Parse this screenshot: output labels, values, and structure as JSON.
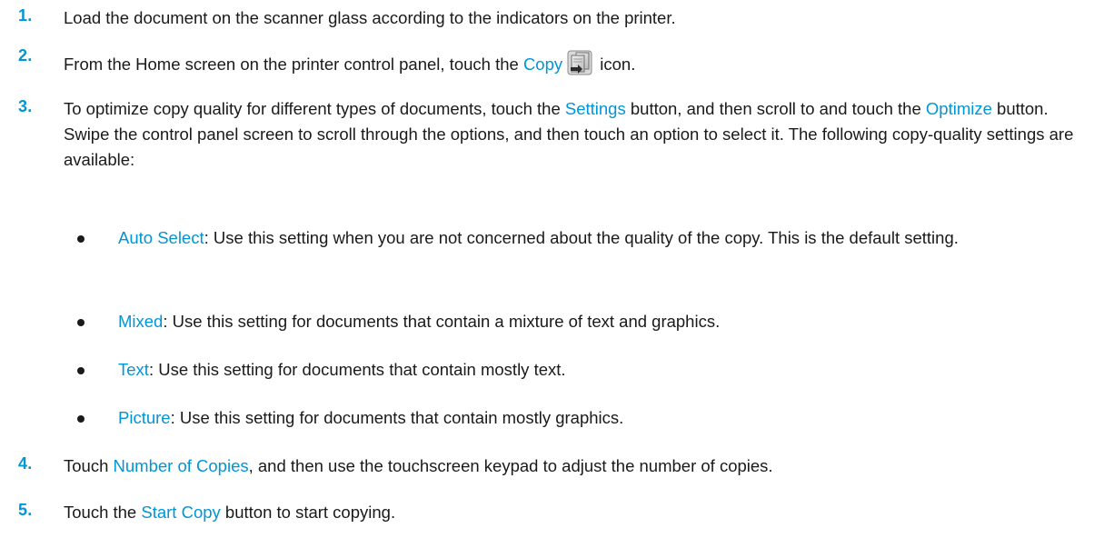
{
  "steps": [
    {
      "number": "1.",
      "text": "Load the document on the scanner glass according to the indicators on the printer."
    },
    {
      "number": "2.",
      "pre": "From the Home screen on the printer control panel, touch the ",
      "kw1": "Copy",
      "icon": "copy-icon",
      "post": " icon."
    },
    {
      "number": "3.",
      "pre": "To optimize copy quality for different types of documents, touch the ",
      "kw1": "Settings",
      "mid": " button, and then scroll to and touch the ",
      "kw2": "Optimize",
      "post": " button. Swipe the control panel screen to scroll through the options, and then touch an option to select it. The following copy-quality settings are available:"
    },
    {
      "number": "4.",
      "pre": "Touch ",
      "kw1": "Number of Copies",
      "post": ", and then use the touchscreen keypad to adjust the number of copies."
    },
    {
      "number": "5.",
      "pre": "Touch the ",
      "kw1": "Start Copy",
      "post": " button to start copying."
    }
  ],
  "options": [
    {
      "name": "Auto Select",
      "desc": ": Use this setting when you are not concerned about the quality of the copy. This is the default setting."
    },
    {
      "name": "Mixed",
      "desc": ": Use this setting for documents that contain a mixture of text and graphics."
    },
    {
      "name": "Text",
      "desc": ": Use this setting for documents that contain mostly text."
    },
    {
      "name": "Picture",
      "desc": ": Use this setting for documents that contain mostly graphics."
    }
  ],
  "colors": {
    "accent": "#0096d6",
    "text": "#1a1a1a"
  }
}
